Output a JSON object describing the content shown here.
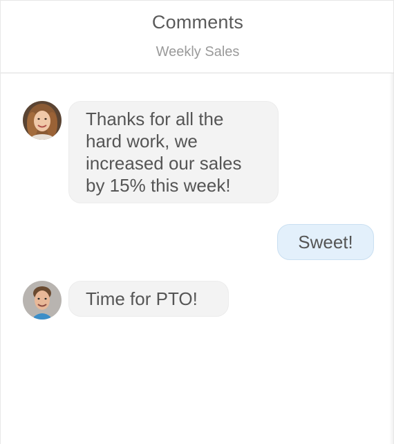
{
  "header": {
    "title": "Comments",
    "subtitle": "Weekly Sales"
  },
  "messages": [
    {
      "sender": "other",
      "avatar": "woman-avatar",
      "text": "Thanks for all the hard work, we increased our sales by 15% this week!"
    },
    {
      "sender": "me",
      "text": "Sweet!"
    },
    {
      "sender": "other",
      "avatar": "man-avatar",
      "text": "Time for PTO!"
    }
  ],
  "colors": {
    "incoming_bubble": "#f3f3f3",
    "outgoing_bubble": "#e3f0fb",
    "text": "#555555"
  }
}
